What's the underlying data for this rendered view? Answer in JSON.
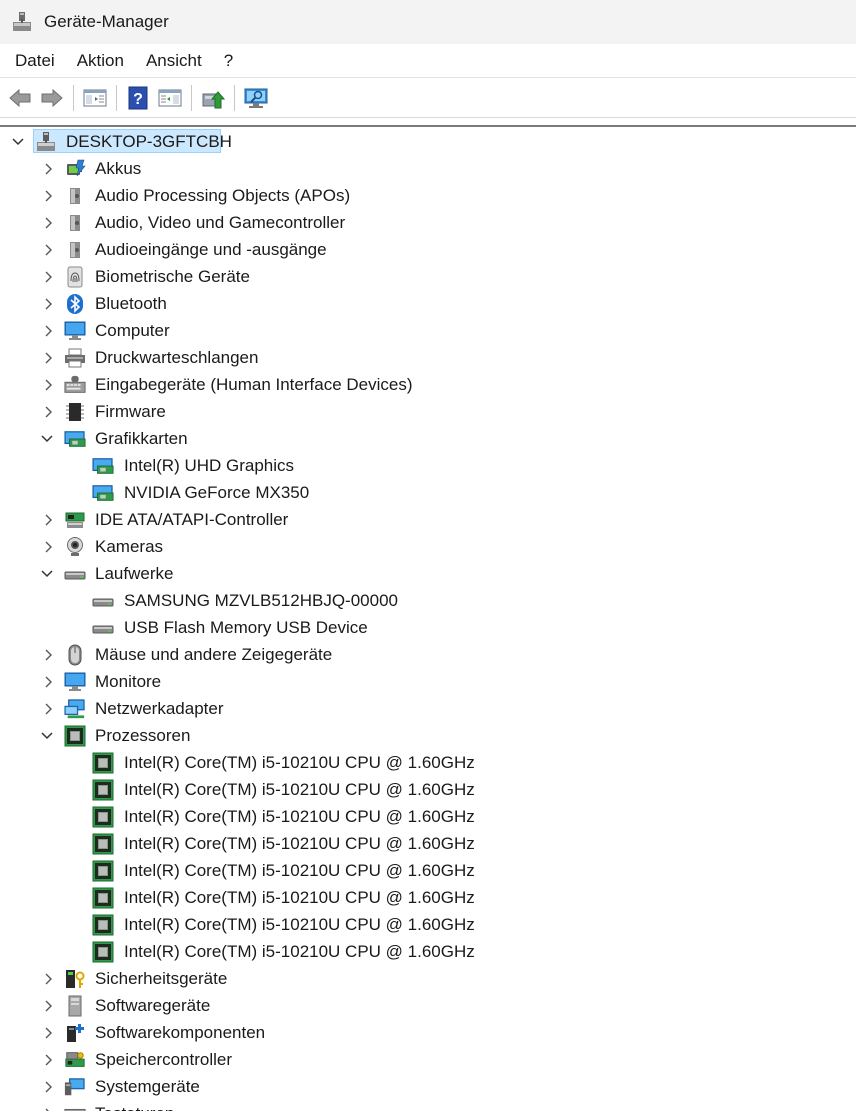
{
  "window": {
    "title": "Geräte-Manager",
    "icon": "device-manager-icon"
  },
  "menu": [
    {
      "label": "Datei"
    },
    {
      "label": "Aktion"
    },
    {
      "label": "Ansicht"
    },
    {
      "label": "?"
    }
  ],
  "toolbar": {
    "buttons": [
      {
        "name": "back-button",
        "icon": "arrow-left-icon"
      },
      {
        "name": "forward-button",
        "icon": "arrow-right-icon"
      },
      {
        "name": "show-hide-console-tree-button",
        "icon": "console-tree-icon"
      },
      {
        "name": "help-button",
        "icon": "help-icon"
      },
      {
        "name": "show-hide-action-pane-button",
        "icon": "action-pane-icon"
      },
      {
        "name": "update-driver-button",
        "icon": "update-driver-icon"
      },
      {
        "name": "scan-hardware-changes-button",
        "icon": "scan-monitor-icon"
      }
    ]
  },
  "tree": {
    "root": {
      "label": "DESKTOP-3GFTCBH",
      "icon": "computer-tower-icon",
      "expanded": true,
      "selected": true
    },
    "items": [
      {
        "label": "Akkus",
        "icon": "battery-icon",
        "expanded": false,
        "level": 1
      },
      {
        "label": "Audio Processing Objects (APOs)",
        "icon": "speaker-icon",
        "expanded": false,
        "level": 1
      },
      {
        "label": "Audio, Video und Gamecontroller",
        "icon": "speaker-icon",
        "expanded": false,
        "level": 1
      },
      {
        "label": "Audioeingänge und -ausgänge",
        "icon": "speaker-icon",
        "expanded": false,
        "level": 1
      },
      {
        "label": "Biometrische Geräte",
        "icon": "fingerprint-icon",
        "expanded": false,
        "level": 1
      },
      {
        "label": "Bluetooth",
        "icon": "bluetooth-icon",
        "expanded": false,
        "level": 1
      },
      {
        "label": "Computer",
        "icon": "monitor-icon",
        "expanded": false,
        "level": 1
      },
      {
        "label": "Druckwarteschlangen",
        "icon": "printer-icon",
        "expanded": false,
        "level": 1
      },
      {
        "label": "Eingabegeräte (Human Interface Devices)",
        "icon": "keyboard-hid-icon",
        "expanded": false,
        "level": 1
      },
      {
        "label": "Firmware",
        "icon": "chip-icon",
        "expanded": false,
        "level": 1
      },
      {
        "label": "Grafikkarten",
        "icon": "display-adapter-icon",
        "expanded": true,
        "level": 1
      },
      {
        "label": "Intel(R) UHD Graphics",
        "icon": "display-adapter-icon",
        "level": 2
      },
      {
        "label": "NVIDIA GeForce MX350",
        "icon": "display-adapter-icon",
        "level": 2
      },
      {
        "label": "IDE ATA/ATAPI-Controller",
        "icon": "ide-controller-icon",
        "expanded": false,
        "level": 1
      },
      {
        "label": "Kameras",
        "icon": "webcam-icon",
        "expanded": false,
        "level": 1
      },
      {
        "label": "Laufwerke",
        "icon": "disk-drive-icon",
        "expanded": true,
        "level": 1
      },
      {
        "label": "SAMSUNG MZVLB512HBJQ-00000",
        "icon": "disk-drive-icon",
        "level": 2
      },
      {
        "label": "USB Flash Memory USB Device",
        "icon": "disk-drive-icon",
        "level": 2
      },
      {
        "label": "Mäuse und andere Zeigegeräte",
        "icon": "mouse-icon",
        "expanded": false,
        "level": 1
      },
      {
        "label": "Monitore",
        "icon": "monitor-icon",
        "expanded": false,
        "level": 1
      },
      {
        "label": "Netzwerkadapter",
        "icon": "network-adapter-icon",
        "expanded": false,
        "level": 1
      },
      {
        "label": "Prozessoren",
        "icon": "processor-icon",
        "expanded": true,
        "level": 1
      },
      {
        "label": "Intel(R) Core(TM) i5-10210U CPU @ 1.60GHz",
        "icon": "processor-icon",
        "level": 2
      },
      {
        "label": "Intel(R) Core(TM) i5-10210U CPU @ 1.60GHz",
        "icon": "processor-icon",
        "level": 2
      },
      {
        "label": "Intel(R) Core(TM) i5-10210U CPU @ 1.60GHz",
        "icon": "processor-icon",
        "level": 2
      },
      {
        "label": "Intel(R) Core(TM) i5-10210U CPU @ 1.60GHz",
        "icon": "processor-icon",
        "level": 2
      },
      {
        "label": "Intel(R) Core(TM) i5-10210U CPU @ 1.60GHz",
        "icon": "processor-icon",
        "level": 2
      },
      {
        "label": "Intel(R) Core(TM) i5-10210U CPU @ 1.60GHz",
        "icon": "processor-icon",
        "level": 2
      },
      {
        "label": "Intel(R) Core(TM) i5-10210U CPU @ 1.60GHz",
        "icon": "processor-icon",
        "level": 2
      },
      {
        "label": "Intel(R) Core(TM) i5-10210U CPU @ 1.60GHz",
        "icon": "processor-icon",
        "level": 2
      },
      {
        "label": "Sicherheitsgeräte",
        "icon": "security-key-icon",
        "expanded": false,
        "level": 1
      },
      {
        "label": "Softwaregeräte",
        "icon": "software-device-icon",
        "expanded": false,
        "level": 1
      },
      {
        "label": "Softwarekomponenten",
        "icon": "software-component-icon",
        "expanded": false,
        "level": 1
      },
      {
        "label": "Speichercontroller",
        "icon": "storage-controller-icon",
        "expanded": false,
        "level": 1
      },
      {
        "label": "Systemgeräte",
        "icon": "system-device-icon",
        "expanded": false,
        "level": 1
      },
      {
        "label": "Tastaturen",
        "icon": "keyboard-icon",
        "expanded": false,
        "level": 1
      }
    ]
  }
}
